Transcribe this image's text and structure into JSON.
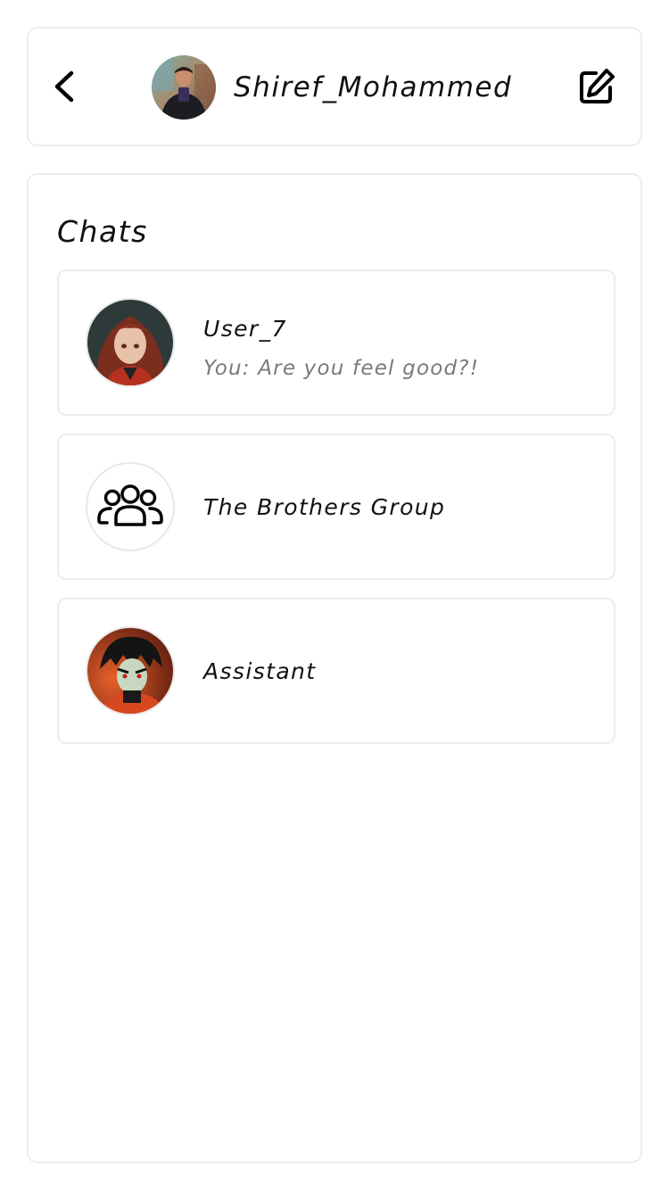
{
  "header": {
    "profile_name": "Shiref_Mohammed",
    "icons": {
      "back": "chevron-left-icon",
      "edit": "edit-pencil-icon",
      "avatar": "profile-photo"
    }
  },
  "chats_section": {
    "title": "Chats",
    "items": [
      {
        "name": "User_7",
        "preview": "You: Are you feel good?!",
        "avatar": "anime-girl-avatar"
      },
      {
        "name": "The Brothers Group",
        "preview": "",
        "avatar": "group-icon"
      },
      {
        "name": "Assistant",
        "preview": "",
        "avatar": "anime-boy-avatar"
      }
    ]
  },
  "colors": {
    "border": "#ececec",
    "text": "#111111",
    "muted": "#7a7a7a",
    "background": "#ffffff"
  }
}
